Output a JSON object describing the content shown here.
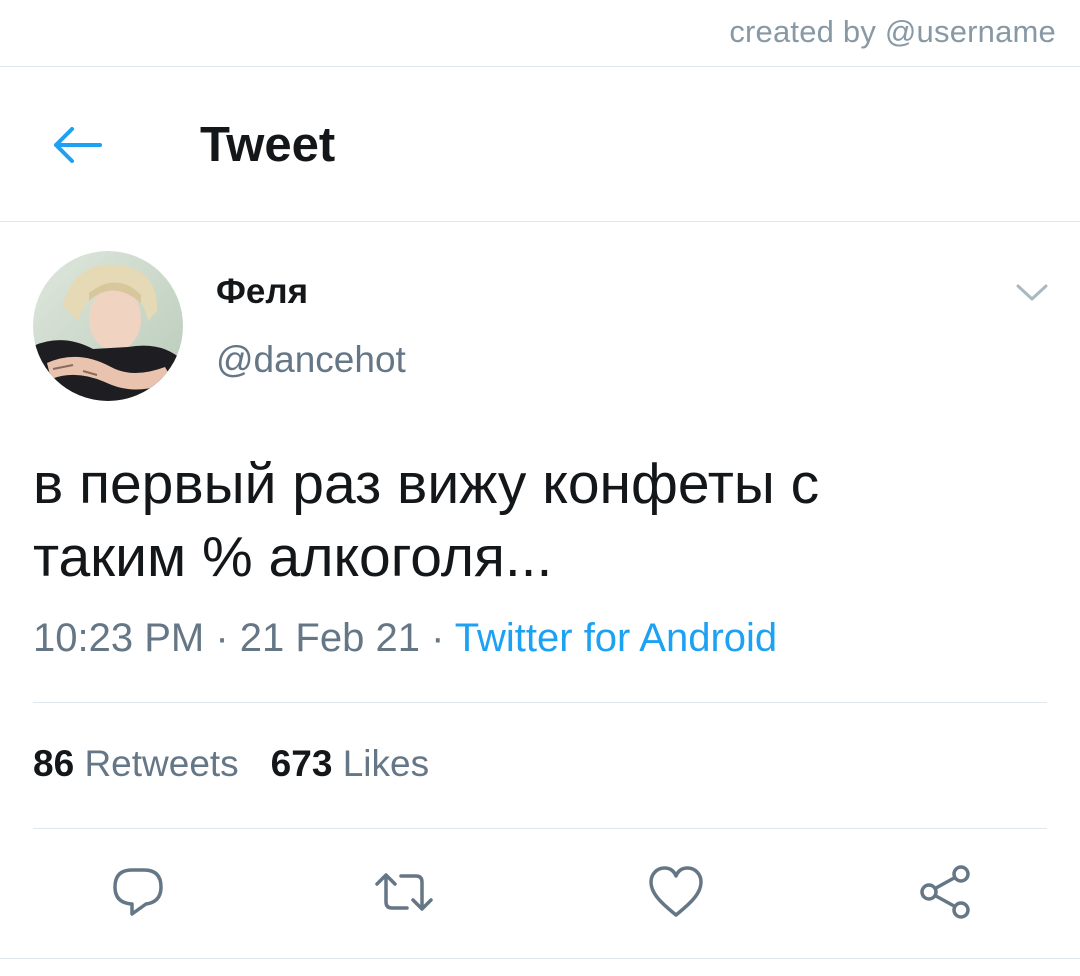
{
  "watermark": "created by @username",
  "header": {
    "title": "Tweet",
    "back_icon": "arrow-left-icon"
  },
  "author": {
    "display_name": "Феля",
    "handle": "@dancehot"
  },
  "tweet": {
    "lines": [
      "в первый раз вижу конфеты с",
      "таким % алкоголя..."
    ],
    "time": "10:23 PM",
    "date": "21 Feb 21",
    "separator": "·",
    "source": "Twitter for Android"
  },
  "stats": {
    "retweets_count": "86",
    "retweets_label": "Retweets",
    "likes_count": "673",
    "likes_label": "Likes"
  },
  "actions": {
    "icons": [
      "reply-icon",
      "retweet-icon",
      "like-icon",
      "share-icon"
    ]
  },
  "colors": {
    "accent": "#1da1f2",
    "secondary_text": "#657786",
    "icon_gray": "#657786",
    "divider": "#e1e8ed"
  }
}
